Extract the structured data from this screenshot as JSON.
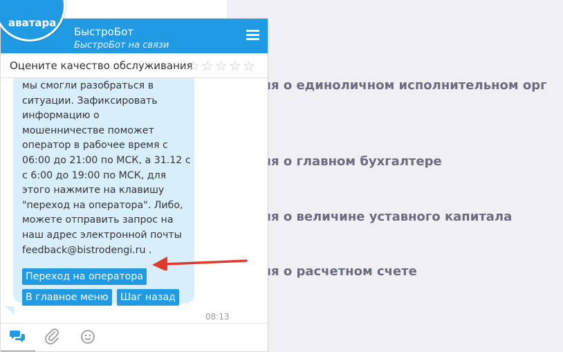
{
  "header": {
    "avatar_label": "аватара",
    "bot_name": "БыстроБот",
    "bot_status": "БыстроБот на связи",
    "menu_icon": "hamburger-menu-icon"
  },
  "rating": {
    "label": "Оцените качество обслуживания",
    "stars": [
      "☆",
      "☆",
      "☆",
      "☆",
      "☆"
    ],
    "max_stars": 5
  },
  "message": {
    "lines": "мы смогли разобраться в\nситуации. Зафиксировать\nинформацию о\nмошенничестве поможет\nоператор в рабочее время с\n06:00 до 21:00 по МСК, а 31.12 с\nс 6:00 до 19:00 по МСК, для\nэтого нажмите на клавишу\n\"переход на оператора\". Либо,\nможете отправить запрос на\nнаш адрес электронной почты\nfeedback@bistrodengi.ru .",
    "time": "08:13"
  },
  "buttons": {
    "operator": "Переход на оператора",
    "main_menu": "В главное меню",
    "back": "Шаг назад"
  },
  "page_sections": [
    "едения о единоличном исполнительном орг",
    "едения о главном бухгалтере",
    "едения о величине уставного капитала",
    "едения о расчетном счете"
  ],
  "footer": {
    "icons": [
      "chat-bubbles-icon",
      "paperclip-icon",
      "smiley-icon"
    ]
  },
  "colors": {
    "accent": "#1f9ae3",
    "bubble": "#d9eefb",
    "arrow": "#e03a2c",
    "heading_text": "#6b6b80"
  }
}
